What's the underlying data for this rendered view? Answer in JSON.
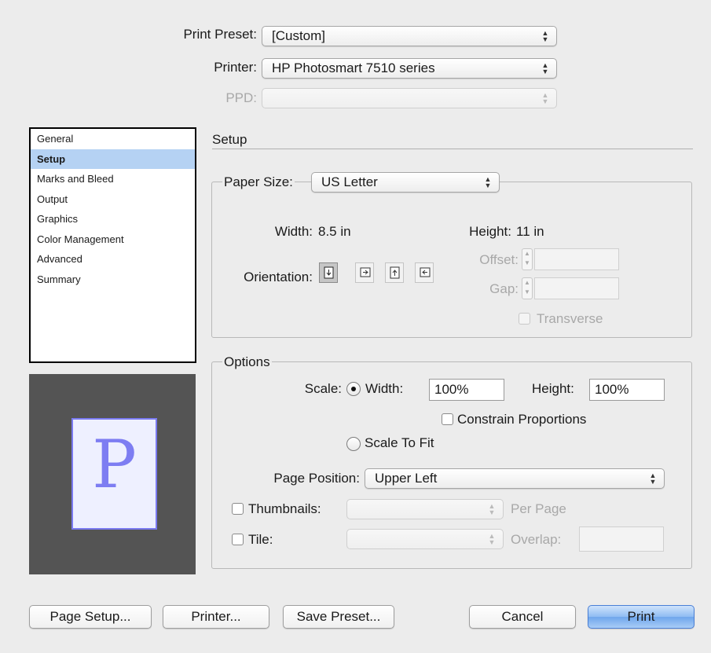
{
  "header": {
    "preset_label": "Print Preset:",
    "preset_value": "[Custom]",
    "printer_label": "Printer:",
    "printer_value": "HP Photosmart 7510 series",
    "ppd_label": "PPD:",
    "ppd_value": ""
  },
  "sidebar": {
    "items": [
      {
        "label": "General"
      },
      {
        "label": "Setup"
      },
      {
        "label": "Marks and Bleed"
      },
      {
        "label": "Output"
      },
      {
        "label": "Graphics"
      },
      {
        "label": "Color Management"
      },
      {
        "label": "Advanced"
      },
      {
        "label": "Summary"
      }
    ],
    "selected": "Setup"
  },
  "preview": {
    "glyph": "P"
  },
  "setup": {
    "section_title": "Setup",
    "paper_size_label": "Paper Size:",
    "paper_size_value": "US Letter",
    "width_label": "Width:",
    "width_value": "8.5 in",
    "height_label": "Height:",
    "height_value": "11 in",
    "orientation_label": "Orientation:",
    "orientation_options": [
      "portrait-icon",
      "landscape-icon",
      "reverse-portrait-icon",
      "reverse-landscape-icon"
    ],
    "offset_label": "Offset:",
    "offset_value": "",
    "gap_label": "Gap:",
    "gap_value": "",
    "transverse_label": "Transverse"
  },
  "options": {
    "legend": "Options",
    "scale_label": "Scale:",
    "width_radio_label": "Width:",
    "scale_width_value": "100%",
    "height_label": "Height:",
    "scale_height_value": "100%",
    "constrain_label": "Constrain Proportions",
    "scale_to_fit_label": "Scale To Fit",
    "page_position_label": "Page Position:",
    "page_position_value": "Upper Left",
    "thumbnails_label": "Thumbnails:",
    "thumbnails_value": "",
    "per_page_label": "Per Page",
    "tile_label": "Tile:",
    "tile_value": "",
    "overlap_label": "Overlap:",
    "overlap_value": ""
  },
  "buttons": {
    "page_setup": "Page Setup...",
    "printer": "Printer...",
    "save_preset": "Save Preset...",
    "cancel": "Cancel",
    "print": "Print"
  },
  "colors": {
    "accent_selection": "#b5d2f3",
    "default_button": "#7fb2f0",
    "preview_background": "#545454",
    "preview_glyph": "#7d7df2"
  }
}
